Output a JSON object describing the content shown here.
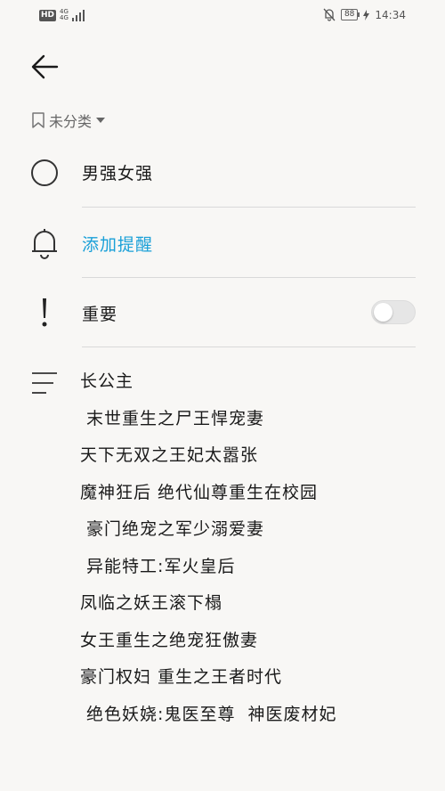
{
  "status_bar": {
    "hd": "HD",
    "network": "4G",
    "signal_sub": "4G",
    "battery": "88",
    "time": "14:34",
    "icons": [
      "hd-icon",
      "signal-icon",
      "mute-icon",
      "battery-icon",
      "charging-icon"
    ]
  },
  "header": {
    "back_icon": "arrow-left-icon"
  },
  "category": {
    "label": "未分类",
    "icon": "bookmark-icon",
    "dropdown_icon": "triangle-down-icon"
  },
  "task": {
    "title": "男强女强",
    "checkbox_icon": "circle-icon"
  },
  "reminder": {
    "label": "添加提醒",
    "icon": "bell-icon",
    "color": "#1aa0d8"
  },
  "important": {
    "label": "重要",
    "icon": "exclamation-icon",
    "toggle_on": false
  },
  "notes": {
    "icon": "notes-lines-icon",
    "lines": [
      "长公主",
      " 末世重生之尸王悍宠妻",
      "天下无双之王妃太嚣张",
      "魔神狂后 绝代仙尊重生在校园",
      " 豪门绝宠之军少溺爱妻",
      " 异能特工:军火皇后",
      "凤临之妖王滚下榻",
      "女王重生之绝宠狂傲妻",
      "豪门权妇 重生之王者时代",
      " 绝色妖娆:鬼医至尊  神医废材妃"
    ]
  }
}
